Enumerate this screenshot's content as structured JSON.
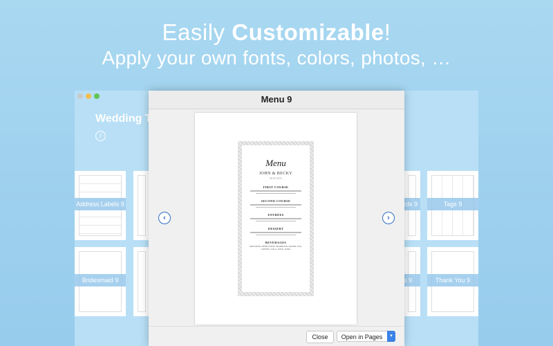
{
  "hero": {
    "title_plain": "Easily ",
    "title_bold": "Customizable",
    "title_end": "!",
    "subtitle": "Apply your own fonts, colors, photos, …"
  },
  "background_window": {
    "title_partial": "Wedding T",
    "info_symbol": "i",
    "thumbnails": {
      "left_top": "Address Labels 9",
      "left_bottom": "Bridesmaid 9",
      "right_top_partial": "rds 9",
      "right_top": "Tags 9",
      "right_bottom_partial": "s 9",
      "right_bottom": "Thank You 9"
    }
  },
  "dialog": {
    "title": "Menu 9",
    "close_label": "Close",
    "open_label": "Open in Pages",
    "prev_symbol": "‹",
    "next_symbol": "›"
  },
  "menu_preview": {
    "heading": "Menu",
    "names": "JOHN & BECKY",
    "date": "06.05.2015",
    "sections": [
      "FIRST COURSE",
      "SECOND COURSE",
      "ENTRÉES",
      "DESSERT",
      "BEVERAGES"
    ],
    "beverages_text": "RED WINE, WHITE WINE, SPARKLING WATER, TEA, COFFEE, COLA, JUICE, SODA"
  },
  "colors": {
    "background": "#a9d8f1",
    "accent_blue": "#2e6fc4",
    "button_blue": "#3b82e6"
  }
}
